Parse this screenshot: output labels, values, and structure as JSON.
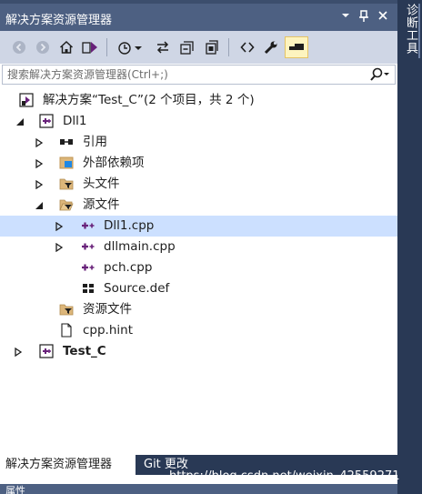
{
  "window": {
    "title": "解决方案资源管理器",
    "pin_icon": "pin-icon",
    "dropdown_icon": "dropdown-icon",
    "close_icon": "close-icon"
  },
  "toolbar": {
    "items": [
      "back-icon",
      "forward-icon",
      "home-icon",
      "switch-views-icon",
      "pending-changes-filter-icon",
      "sync-icon",
      "collapse-all-icon",
      "show-all-files-icon",
      "code-view-icon",
      "properties-icon",
      "preview-selected-icon"
    ]
  },
  "search": {
    "placeholder": "搜索解决方案资源管理器(Ctrl+;)"
  },
  "tree": {
    "solution": "解决方案“Test_C”(2 个项目，共 2 个)",
    "project1": "Dll1",
    "references": "引用",
    "external_deps": "外部依赖项",
    "header_files": "头文件",
    "source_files": "源文件",
    "file_dll1": "Dll1.cpp",
    "file_dllmain": "dllmain.cpp",
    "file_pch": "pch.cpp",
    "file_source_def": "Source.def",
    "resource_files": "资源文件",
    "file_hint": "cpp.hint",
    "project2": "Test_C"
  },
  "tabs": {
    "solution_explorer": "解决方案资源管理器",
    "git_changes": "Git 更改"
  },
  "watermark": "https://blog.csdn.net/weixin_42559271",
  "right_panel": {
    "label": "诊断工具"
  },
  "bottom_panel": {
    "label": "属性"
  },
  "colors": {
    "accent": "#4d6082",
    "selection": "#cce0ff",
    "toolbar_bg": "#cfd6e5"
  }
}
